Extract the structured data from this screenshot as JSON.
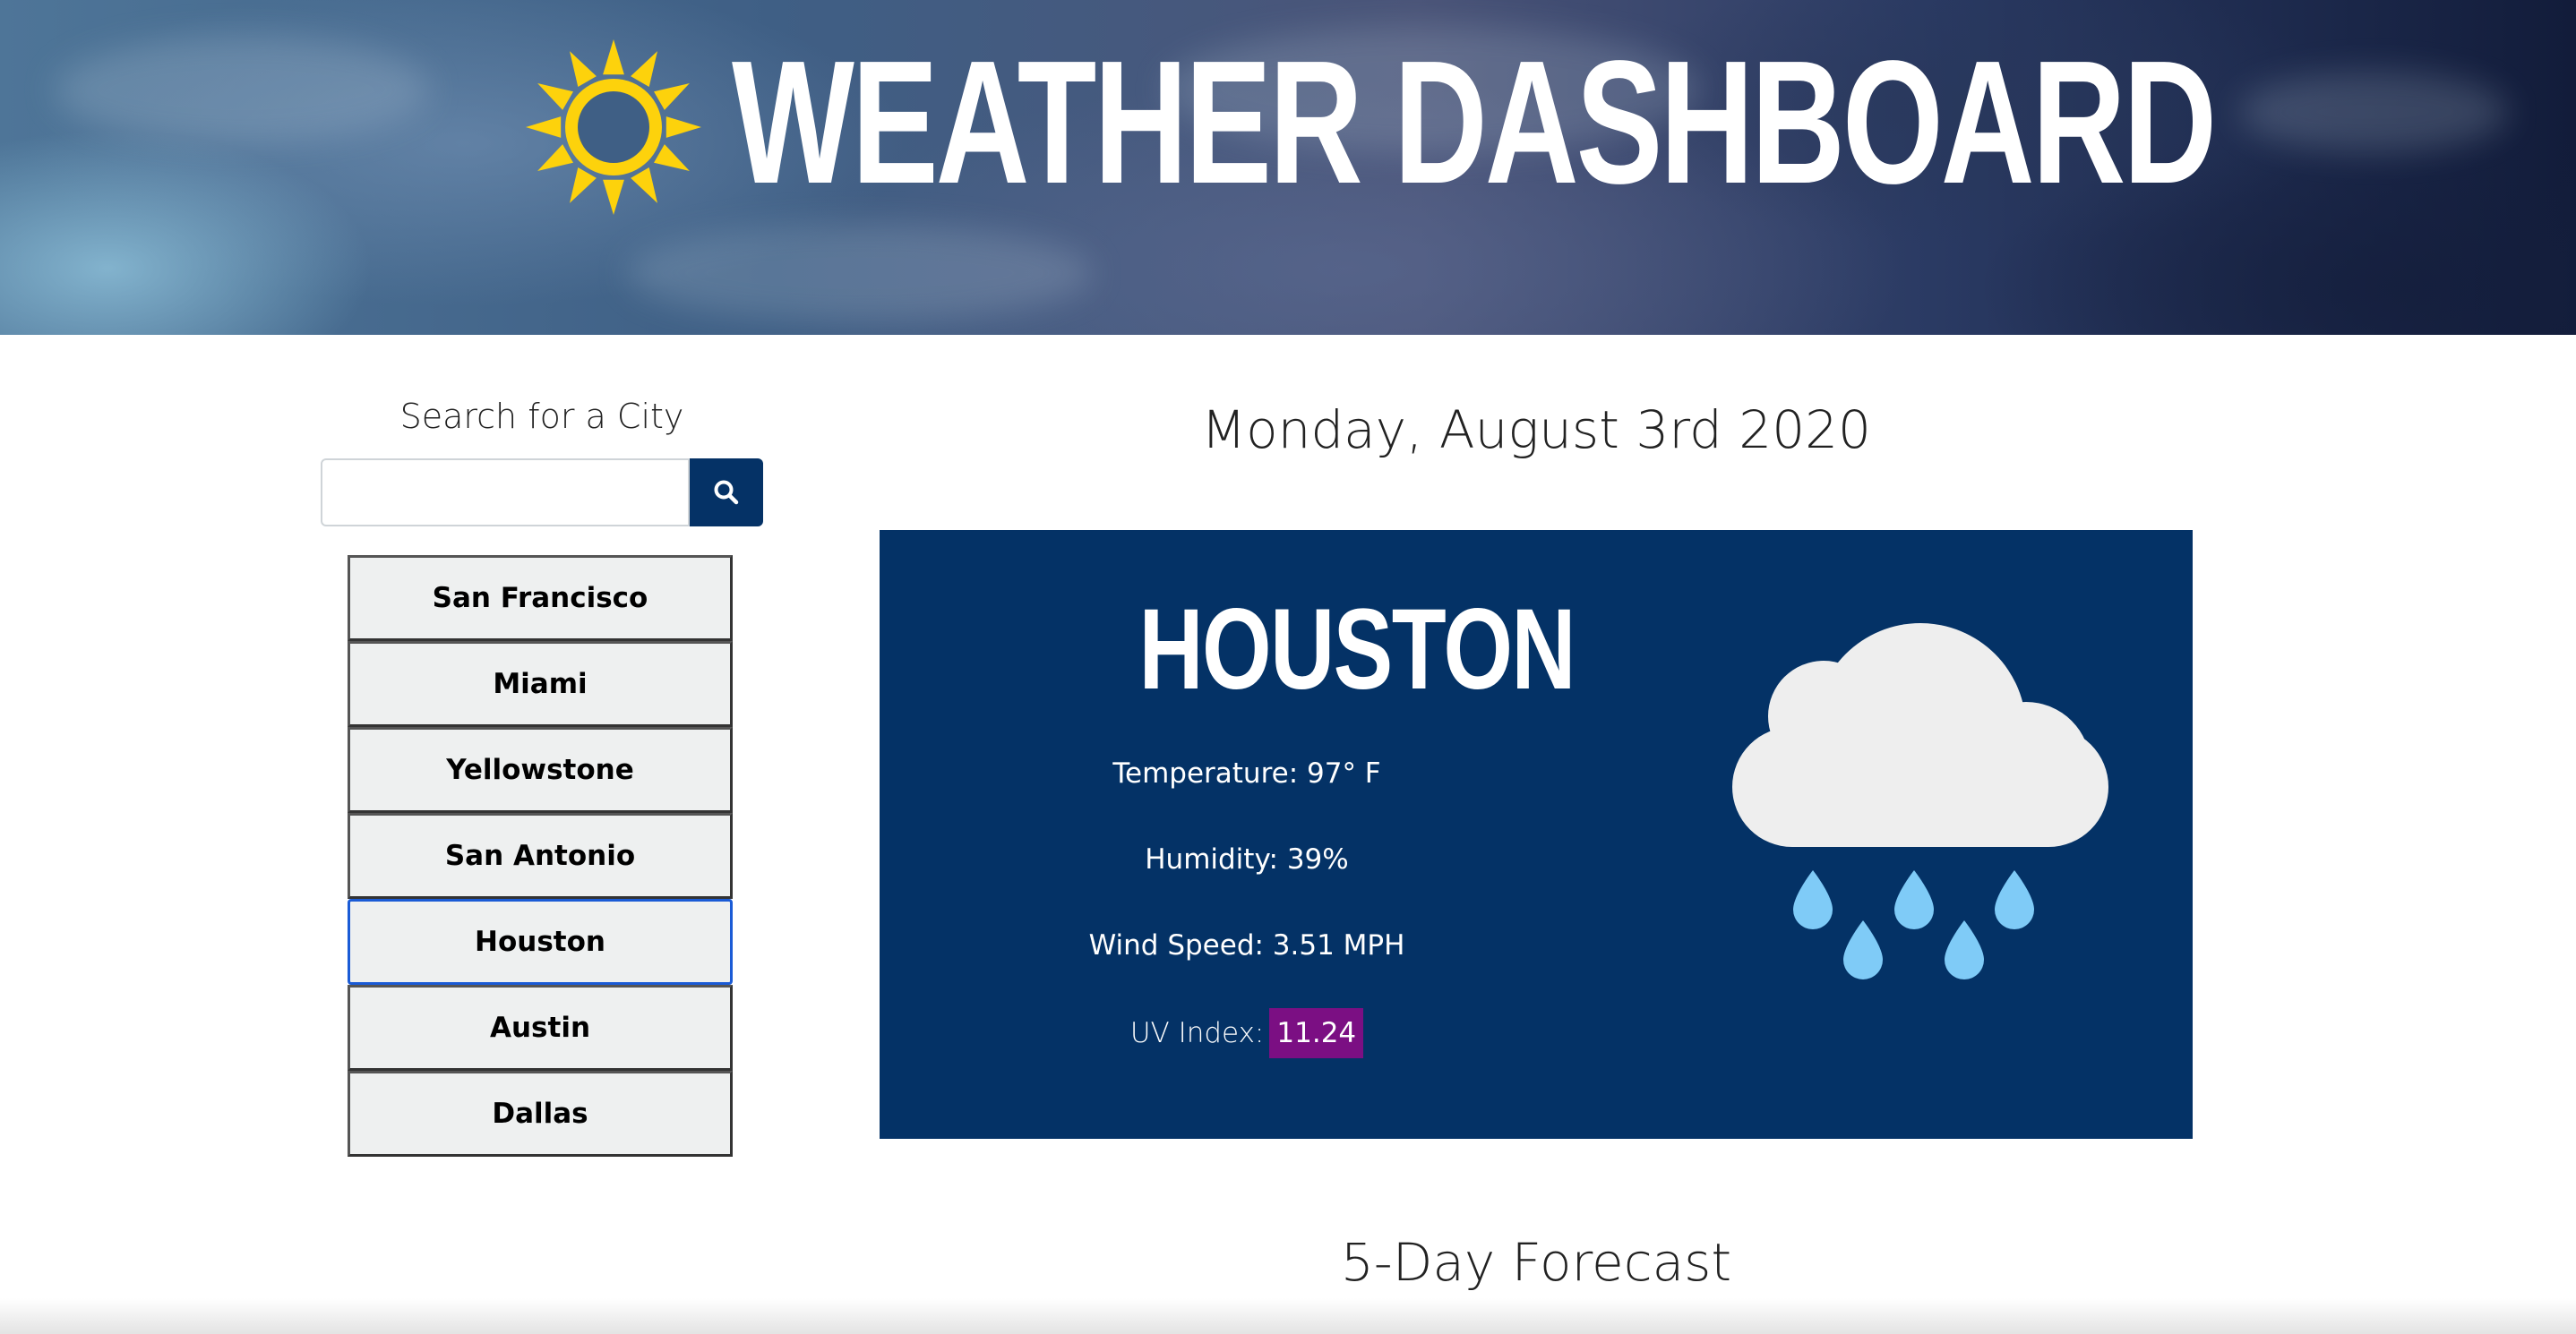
{
  "header": {
    "title": "WEATHER DASHBOARD",
    "logo_icon": "sun-icon",
    "logo_color": "#FDD20C"
  },
  "sidebar": {
    "search_label": "Search for a City",
    "search_value": "",
    "search_button_icon": "search-icon",
    "cities": [
      {
        "label": "San Francisco",
        "active": false
      },
      {
        "label": "Miami",
        "active": false
      },
      {
        "label": "Yellowstone",
        "active": false
      },
      {
        "label": "San Antonio",
        "active": false
      },
      {
        "label": "Houston",
        "active": true
      },
      {
        "label": "Austin",
        "active": false
      },
      {
        "label": "Dallas",
        "active": false
      }
    ]
  },
  "main": {
    "date": "Monday, August 3rd 2020",
    "current": {
      "city": "HOUSTON",
      "temperature": "Temperature: 97° F",
      "humidity": "Humidity: 39%",
      "wind_speed": "Wind Speed: 3.51 MPH",
      "uv_label": "UV Index:",
      "uv_value": "11.24",
      "weather_icon": "rain-cloud-icon"
    },
    "forecast_title": "5-Day Forecast"
  },
  "colors": {
    "brand_navy": "#043266",
    "uv_badge": "#7B0F83",
    "active_border": "#1A5BD6",
    "rain_drop": "#7FCBF7",
    "cloud": "#EEEEEE"
  }
}
